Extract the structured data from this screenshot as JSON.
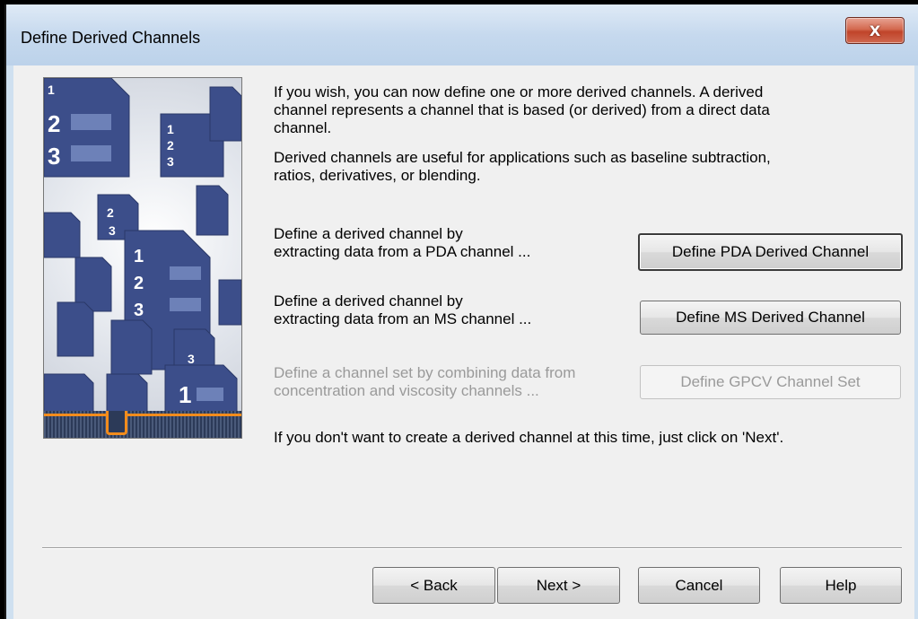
{
  "window": {
    "title": "Define Derived Channels",
    "close_glyph": "X"
  },
  "intro": {
    "line1": "If you wish, you can now define one or more derived channels.  A derived",
    "line2": "channel represents a channel that is based (or derived) from a direct data",
    "line3": "channel.",
    "line4": "Derived channels are useful for applications such as baseline subtraction,",
    "line5": "ratios, derivatives, or blending."
  },
  "options": [
    {
      "desc_line1": "Define a derived channel by",
      "desc_line2": "extracting data from a PDA channel ...",
      "button": "Define PDA Derived Channel",
      "enabled": true
    },
    {
      "desc_line1": "Define a derived channel by",
      "desc_line2": "extracting data from an MS channel ...",
      "button": "Define MS Derived Channel",
      "enabled": true
    },
    {
      "desc_line1": "Define a channel set by combining data from",
      "desc_line2": "concentration and viscosity channels ...",
      "button": "Define GPCV Channel Set",
      "enabled": false
    }
  ],
  "footer_note": "If you don't want to create a derived channel at this time, just click on 'Next'.",
  "buttons": {
    "back": "< Back",
    "next": "Next >",
    "cancel": "Cancel",
    "help": "Help"
  },
  "art": {
    "digits": [
      "1",
      "2",
      "3"
    ]
  },
  "colors": {
    "title_bar": "#cfe0f0",
    "close_button": "#c94b32",
    "client_bg": "#f0f0f0",
    "doc_blue": "#3c4e8a",
    "accent_orange": "#f28c1c",
    "disabled_text": "#9a9a9a"
  }
}
